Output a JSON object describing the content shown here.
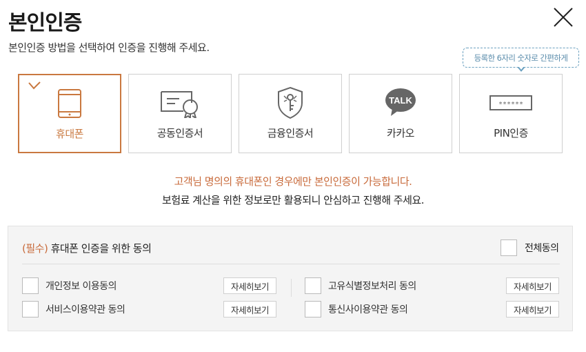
{
  "header": {
    "title": "본인인증",
    "subtitle": "본인인증 방법을 선택하여 인증을 진행해 주세요."
  },
  "tooltip": "등록한 6자리 숫자로 간편하게",
  "methods": [
    {
      "label": "휴대폰",
      "icon": "smartphone-icon",
      "selected": true
    },
    {
      "label": "공동인증서",
      "icon": "certificate-icon",
      "selected": false
    },
    {
      "label": "금융인증서",
      "icon": "shield-key-icon",
      "selected": false
    },
    {
      "label": "카카오",
      "icon": "kakao-talk-icon",
      "icon_text": "TALK",
      "selected": false
    },
    {
      "label": "PIN인증",
      "icon": "pin-field-icon",
      "icon_text": "******",
      "selected": false
    }
  ],
  "notice": {
    "line1": "고객님 명의의 휴대폰인 경우에만 본인인증이 가능합니다.",
    "line2": "보험료 계산을 위한 정보로만 활용되니 안심하고 진행해 주세요."
  },
  "agreement": {
    "required_tag": "(필수)",
    "title": " 휴대폰 인증을 위한 동의",
    "agree_all": "전체동의",
    "detail_label": "자세히보기",
    "items": [
      {
        "label": "개인정보 이용동의"
      },
      {
        "label": "고유식별정보처리 동의"
      },
      {
        "label": "서비스이용약관 동의"
      },
      {
        "label": "통신사이용약관 동의"
      }
    ]
  },
  "colors": {
    "accent": "#c9783f",
    "notice": "#c86a3a",
    "tooltip": "#5a8cab",
    "kakao_bubble": "#666666"
  }
}
